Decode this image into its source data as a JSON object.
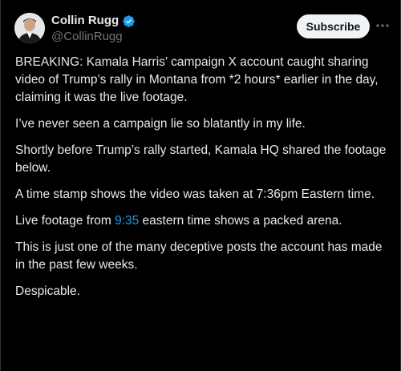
{
  "author": {
    "display_name": "Collin Rugg",
    "handle": "@CollinRugg",
    "verified_badge_color": "#1d9bf0",
    "verified_icon": "verified-badge-icon"
  },
  "actions": {
    "subscribe_label": "Subscribe",
    "more_icon": "more-horizontal-icon"
  },
  "post": {
    "paragraphs": [
      "BREAKING: Kamala Harris’ campaign X account caught sharing video of Trump’s rally in Montana from *2 hours* earlier in the day, claiming it was the live footage.",
      "I’ve never seen a campaign lie so blatantly in my life.",
      "Shortly before Trump’s rally started, Kamala HQ shared the footage below.",
      "A time stamp shows the video was taken at 7:36pm Eastern time."
    ],
    "p5_before": "Live footage from ",
    "p5_link": "9:35",
    "p5_after": " eastern time shows a packed arena.",
    "p6": "This is just one of the many deceptive posts the account has made in the past few weeks.",
    "p7": "Despicable."
  }
}
